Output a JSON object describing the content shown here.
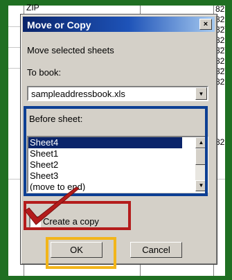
{
  "background_sheet": {
    "header_fragment": "ZIP",
    "row_number_fragments": [
      "82",
      "82",
      "82",
      "82",
      "82",
      "82",
      "82",
      "82",
      "82"
    ]
  },
  "dialog": {
    "title": "Move or Copy",
    "close_label": "×",
    "move_selected_label": "Move selected sheets",
    "to_book_label": "To book:",
    "to_book_value": "sampleaddressbook.xls",
    "before_sheet_label": "Before sheet:",
    "sheets": [
      "Sheet4",
      "Sheet1",
      "Sheet2",
      "Sheet3",
      "(move to end)"
    ],
    "selected_sheet": "Sheet4",
    "create_copy_label": "Create a copy",
    "create_copy_checked": true,
    "ok_label": "OK",
    "cancel_label": "Cancel"
  },
  "annotations": {
    "blue_box_color": "#0d3f93",
    "red_box_color": "#b41c1c",
    "yellow_box_color": "#f2b51b",
    "checkmark_color": "#b41c1c"
  }
}
